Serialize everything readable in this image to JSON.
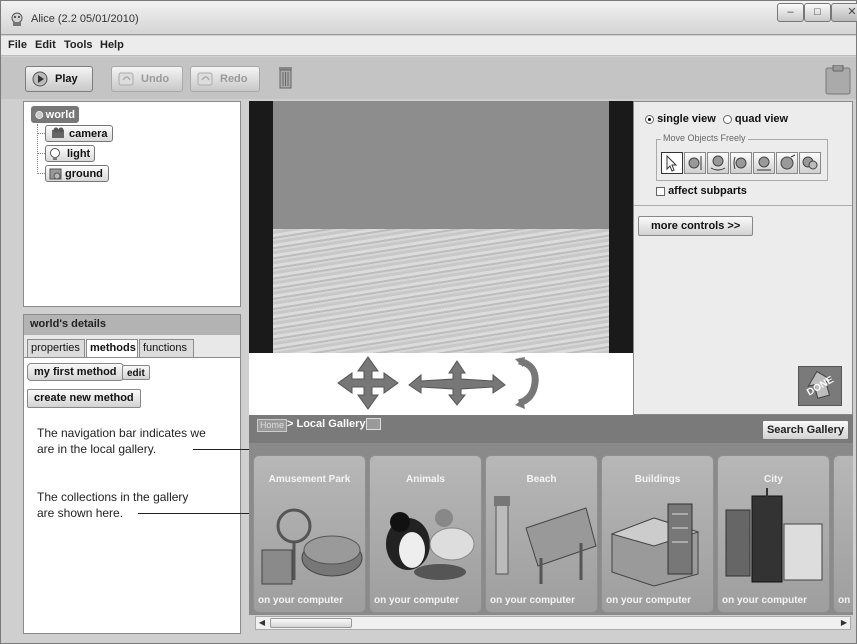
{
  "window": {
    "title": "Alice (2.2 05/01/2010)",
    "controls": {
      "minimize": "–",
      "maximize": "□",
      "close": "✕"
    }
  },
  "menu": [
    "File",
    "Edit",
    "Tools",
    "Help"
  ],
  "toolbar": {
    "play": "Play",
    "undo": "Undo",
    "redo": "Redo"
  },
  "object_tree": {
    "root": "world",
    "children": [
      "camera",
      "light",
      "ground"
    ]
  },
  "details": {
    "header": "world's details",
    "tabs": [
      "properties",
      "methods",
      "functions"
    ],
    "active_tab": "methods",
    "method": "my first method",
    "edit": "edit",
    "create": "create new method"
  },
  "controls": {
    "single_view": "single view",
    "quad_view": "quad view",
    "move_group": "Move Objects Freely",
    "affect_subparts": "affect subparts",
    "more_controls": "more controls >>",
    "done_label": "DONE"
  },
  "gallery_nav": {
    "home": "Home",
    "breadcrumb": "> Local Gallery",
    "search": "Search Gallery"
  },
  "gallery": {
    "cards": [
      {
        "title": "Amusement Park",
        "footer": "on your computer"
      },
      {
        "title": "Animals",
        "footer": "on your computer"
      },
      {
        "title": "Beach",
        "footer": "on your computer"
      },
      {
        "title": "Buildings",
        "footer": "on your computer"
      },
      {
        "title": "City",
        "footer": "on your computer"
      },
      {
        "title": "",
        "footer": "on"
      }
    ]
  },
  "annotations": {
    "nav_line1": "The navigation bar indicates we",
    "nav_line2": "are in the local gallery.",
    "col_line1": "The collections in the gallery",
    "col_line2": "are shown here."
  },
  "icons": {
    "app": "alice-icon",
    "trash": "trash-icon",
    "clipboard": "clipboard-icon"
  }
}
